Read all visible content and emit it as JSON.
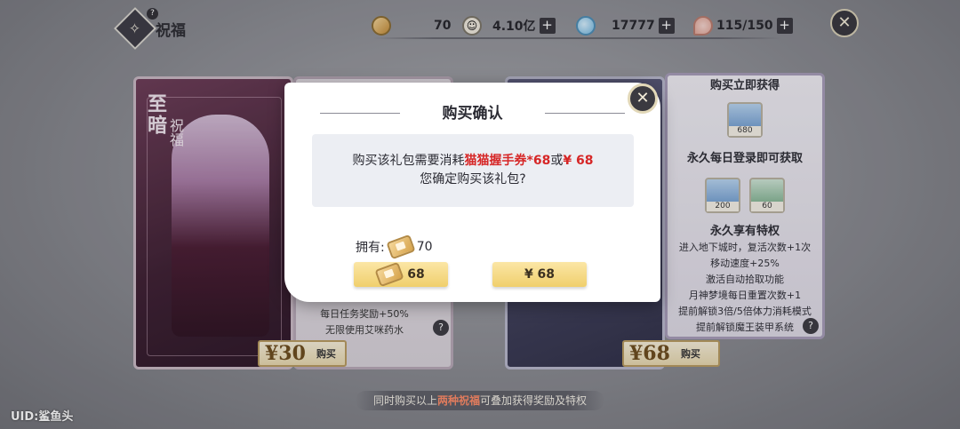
{
  "header": {
    "title": "祝福",
    "help_glyph": "?",
    "emblem_glyph": "✧"
  },
  "resources": [
    {
      "name": "ticket",
      "value": "70"
    },
    {
      "name": "coin",
      "value": "4.10亿"
    },
    {
      "name": "slime",
      "value": "17777"
    },
    {
      "name": "stamina",
      "value": "115/150"
    }
  ],
  "plus_glyph": "+",
  "close_glyph": "✕",
  "cards": {
    "left_title": "至暗",
    "left_subtitle": "祝福",
    "left_benefits": [
      "每日任务奖励+50%",
      "无限使用艾咪药水"
    ],
    "left_price": "¥30",
    "left_buy": "购买",
    "right_price": "¥68",
    "right_buy": "购买",
    "right_panel": {
      "head": "购买立即获得",
      "item1_count": "680",
      "permanent_daily": "永久每日登录即可获取",
      "item2_count": "200",
      "item3_count": "60",
      "privilege_head": "永久享有特权",
      "privileges": [
        "进入地下城时，复活次数+1次",
        "移动速度+25%",
        "激活自动拾取功能",
        "月神梦境每日重置次数+1",
        "提前解锁3倍/5倍体力消耗模式",
        "提前解锁魔王装甲系统"
      ]
    }
  },
  "bottom_note": {
    "pre": "同时购买以上",
    "highlight": "两种祝福",
    "post": "可叠加获得奖励及特权"
  },
  "uid": "UID:鲨鱼头",
  "modal": {
    "title": "购买确认",
    "msg_pre": "购买该礼包需要消耗",
    "msg_red1": "猫猫握手券*68",
    "msg_mid": "或",
    "msg_red2": "¥ 68",
    "msg_line2": "您确定购买该礼包?",
    "owned_label": "拥有:",
    "owned_value": "70",
    "btn_ticket_value": "68",
    "btn_cash_label": "¥ 68"
  }
}
